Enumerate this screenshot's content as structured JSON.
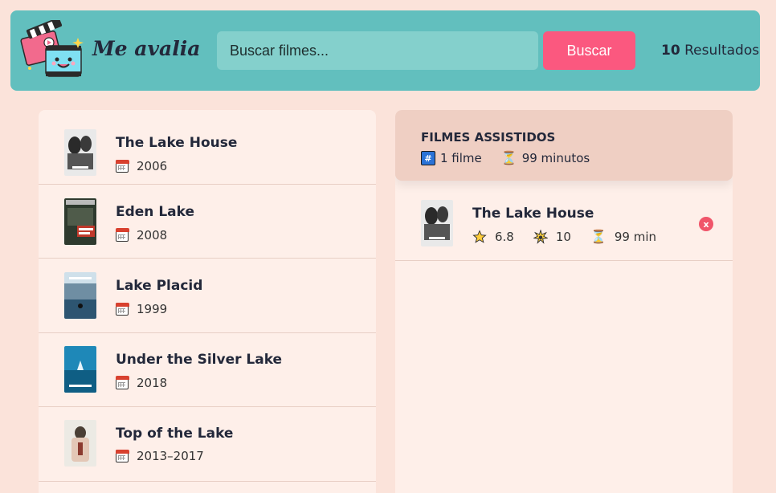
{
  "app": {
    "title": "Me avalia"
  },
  "search": {
    "placeholder": "Buscar filmes...",
    "button_label": "Buscar"
  },
  "results": {
    "count": "10",
    "label": "Resultados"
  },
  "movies": [
    {
      "title": "The Lake House",
      "year": "2006"
    },
    {
      "title": "Eden Lake",
      "year": "2008"
    },
    {
      "title": "Lake Placid",
      "year": "1999"
    },
    {
      "title": "Under the Silver Lake",
      "year": "2018"
    },
    {
      "title": "Top of the Lake",
      "year": "2013–2017"
    }
  ],
  "watched_summary": {
    "heading": "FILMES ASSISTIDOS",
    "count_text": "1 filme",
    "minutes_text": "99 minutos"
  },
  "watched": [
    {
      "title": "The Lake House",
      "rating": "6.8",
      "user_rating": "10",
      "runtime": "99 min",
      "remove_label": "x"
    }
  ],
  "colors": {
    "navbar": "#62bfbe",
    "accent": "#fb587f",
    "background": "#fbe3da",
    "panel": "#feefe9"
  }
}
